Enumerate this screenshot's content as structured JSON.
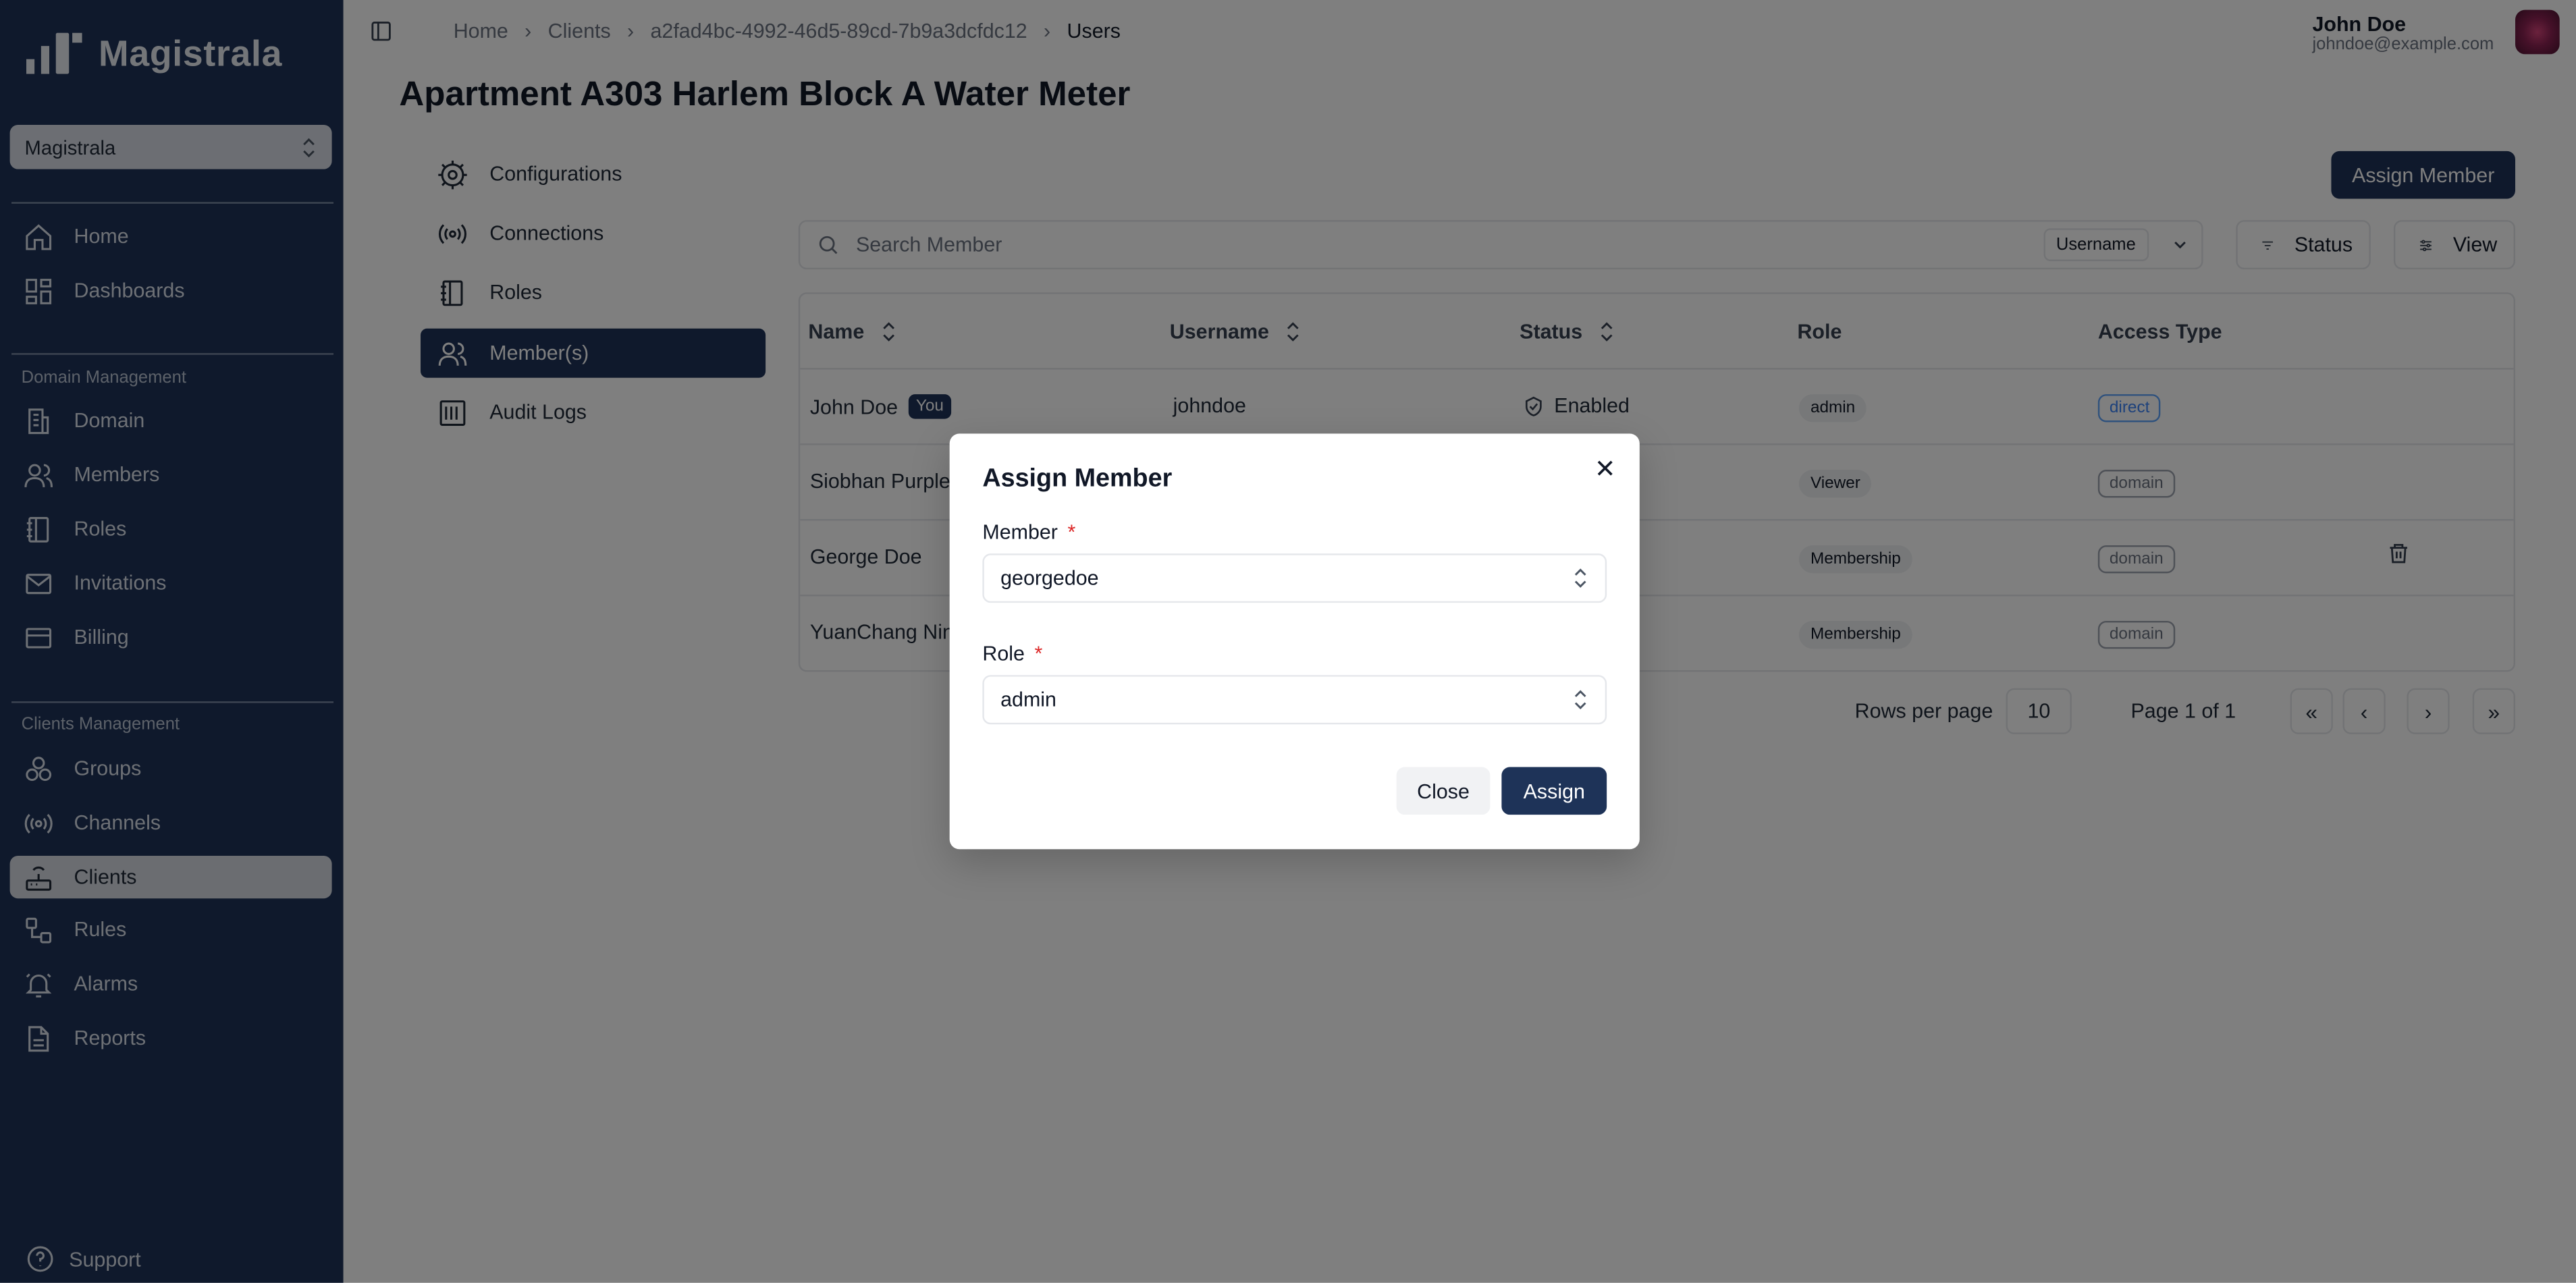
{
  "brand": {
    "name": "Magistrala"
  },
  "sidebar": {
    "domain_select": "Magistrala",
    "top_items": [
      {
        "label": "Home",
        "icon": "home-icon"
      },
      {
        "label": "Dashboards",
        "icon": "dashboard-icon"
      }
    ],
    "domain_section": {
      "title": "Domain Management",
      "items": [
        {
          "label": "Domain",
          "icon": "building-icon"
        },
        {
          "label": "Members",
          "icon": "users-icon"
        },
        {
          "label": "Roles",
          "icon": "notebook-icon"
        },
        {
          "label": "Invitations",
          "icon": "mail-icon"
        },
        {
          "label": "Billing",
          "icon": "credit-card-icon"
        }
      ]
    },
    "clients_section": {
      "title": "Clients Management",
      "items": [
        {
          "label": "Groups",
          "icon": "groups-icon"
        },
        {
          "label": "Channels",
          "icon": "radio-icon"
        },
        {
          "label": "Clients",
          "icon": "router-icon",
          "active": true
        },
        {
          "label": "Rules",
          "icon": "workflow-icon"
        },
        {
          "label": "Alarms",
          "icon": "bell-icon"
        },
        {
          "label": "Reports",
          "icon": "file-icon"
        }
      ]
    },
    "support": "Support"
  },
  "header": {
    "breadcrumb": [
      "Home",
      "Clients",
      "a2fad4bc-4992-46d5-89cd-7b9a3dcfdc12",
      "Users"
    ],
    "user": {
      "name": "John Doe",
      "email": "johndoe@example.com"
    }
  },
  "page": {
    "title": "Apartment A303 Harlem Block A Water Meter",
    "subnav": [
      {
        "label": "Configurations",
        "icon": "gear-icon"
      },
      {
        "label": "Connections",
        "icon": "radio-icon"
      },
      {
        "label": "Roles",
        "icon": "notebook-icon"
      },
      {
        "label": "Member(s)",
        "icon": "users-icon",
        "active": true
      },
      {
        "label": "Audit Logs",
        "icon": "logs-icon"
      }
    ],
    "assign_button": "Assign Member",
    "search": {
      "placeholder": "Search Member",
      "filter": "Username"
    },
    "status_button": "Status",
    "view_button": "View",
    "table": {
      "headers": [
        "Name",
        "Username",
        "Status",
        "Role",
        "Access Type"
      ],
      "rows": [
        {
          "name": "John Doe",
          "you": "You",
          "username": "johndoe",
          "status": "Enabled",
          "role": "admin",
          "access": "direct"
        },
        {
          "name": "Siobhan Purple",
          "role": "Viewer",
          "access": "domain"
        },
        {
          "name": "George Doe",
          "role": "Membership",
          "access": "domain"
        },
        {
          "name": "YuanChang Nin",
          "role": "Membership",
          "access": "domain"
        }
      ]
    },
    "pagination": {
      "rows_label": "Rows per page",
      "rows_value": "10",
      "page_label": "Page 1 of 1"
    }
  },
  "modal": {
    "title": "Assign Member",
    "member_label": "Member",
    "member_value": "georgedoe",
    "role_label": "Role",
    "role_value": "admin",
    "required_mark": "*",
    "close_button": "Close",
    "assign_button": "Assign"
  },
  "colors": {
    "sidebar": "#1e3358",
    "primary": "#1e3358",
    "required": "#dc2626",
    "direct": "#3b82f6"
  }
}
